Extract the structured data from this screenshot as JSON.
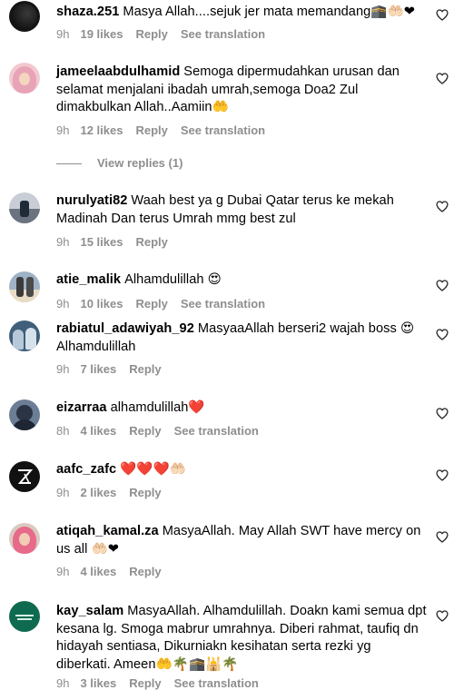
{
  "heart_icon": "heart-outline-icon",
  "comments": [
    {
      "username": "shaza.251",
      "text": "Masya Allah....sejuk jer mata memandang🕋🤲🏻❤",
      "time": "9h",
      "likes": "19 likes",
      "reply": "Reply",
      "translate": "See translation"
    },
    {
      "username": "jameelaabdulhamid",
      "text": "Semoga dipermudahkan urusan dan selamat menjalani ibadah umrah,semoga Doa2 Zul dimakbulkan Allah..Aamiin🤲",
      "time": "9h",
      "likes": "12 likes",
      "reply": "Reply",
      "translate": "See translation"
    },
    {
      "username": "nurulyati82",
      "text": "Waah best ya g Dubai Qatar terus ke mekah Madinah Dan terus Umrah mmg best zul",
      "time": "9h",
      "likes": "15 likes",
      "reply": "Reply",
      "translate": ""
    },
    {
      "username": "atie_malik",
      "text": "Alhamdulillah 😍",
      "time": "9h",
      "likes": "10 likes",
      "reply": "Reply",
      "translate": "See translation"
    },
    {
      "username": "rabiatul_adawiyah_92",
      "text": "MasyaaAllah berseri2 wajah boss 😍 Alhamdulillah",
      "time": "9h",
      "likes": "7 likes",
      "reply": "Reply",
      "translate": ""
    },
    {
      "username": "eizarraa",
      "text": "alhamdulillah❤️",
      "time": "8h",
      "likes": "4 likes",
      "reply": "Reply",
      "translate": "See translation"
    },
    {
      "username": "aafc_zafc",
      "text": "❤️❤️❤️🤲🏻",
      "time": "9h",
      "likes": "2 likes",
      "reply": "Reply",
      "translate": ""
    },
    {
      "username": "atiqah_kamal.za",
      "text": "MasyaAllah. May Allah SWT have mercy on us all 🤲🏻❤",
      "time": "9h",
      "likes": "4 likes",
      "reply": "Reply",
      "translate": ""
    },
    {
      "username": "kay_salam",
      "text": "MasyaAllah. Alhamdulillah. Doakn kami semua dpt kesana lg. Smoga mabrur umrahnya. Diberi rahmat, taufiq dn hidayah sentiasa, Dikurniakn kesihatan serta rezki yg diberkati. Ameen🤲🌴🕋🕌🌴",
      "time": "9h",
      "likes": "3 likes",
      "reply": "Reply",
      "translate": "See translation"
    }
  ],
  "view_replies": "View replies (1)"
}
